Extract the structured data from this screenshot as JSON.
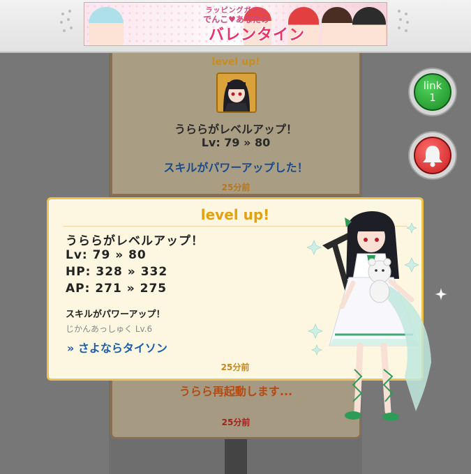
{
  "banner": {
    "line1": "ラッピングガチャ",
    "line2": "でんこ♥あなたの",
    "line3": "バレンタイン"
  },
  "link_button": {
    "label": "link",
    "count": "1"
  },
  "log_back": {
    "title": "level up!",
    "message": "うららがレベルアップ！",
    "level": "Lv: 79 » 80",
    "skill": "スキルがパワーアップした！",
    "time": "25分前"
  },
  "log_back2": {
    "message": "うらら再起動します...",
    "time": "25分前"
  },
  "popup": {
    "title": "level up!",
    "message": "うららがレベルアップ！",
    "lv": "Lv: 79 » 80",
    "hp": "HP: 328 » 332",
    "ap": "AP: 271 » 275",
    "skill_up": "スキルがパワーアップ！",
    "skill_name": "じかんあっしゅく Lv.6",
    "skill_link": "» さよならタイソン",
    "time": "25分前"
  },
  "colors": {
    "accent_gold": "#f0c24b",
    "link_green": "#1c8a27",
    "bell_red": "#c81f1f",
    "skill_blue": "#1d5ca8"
  }
}
